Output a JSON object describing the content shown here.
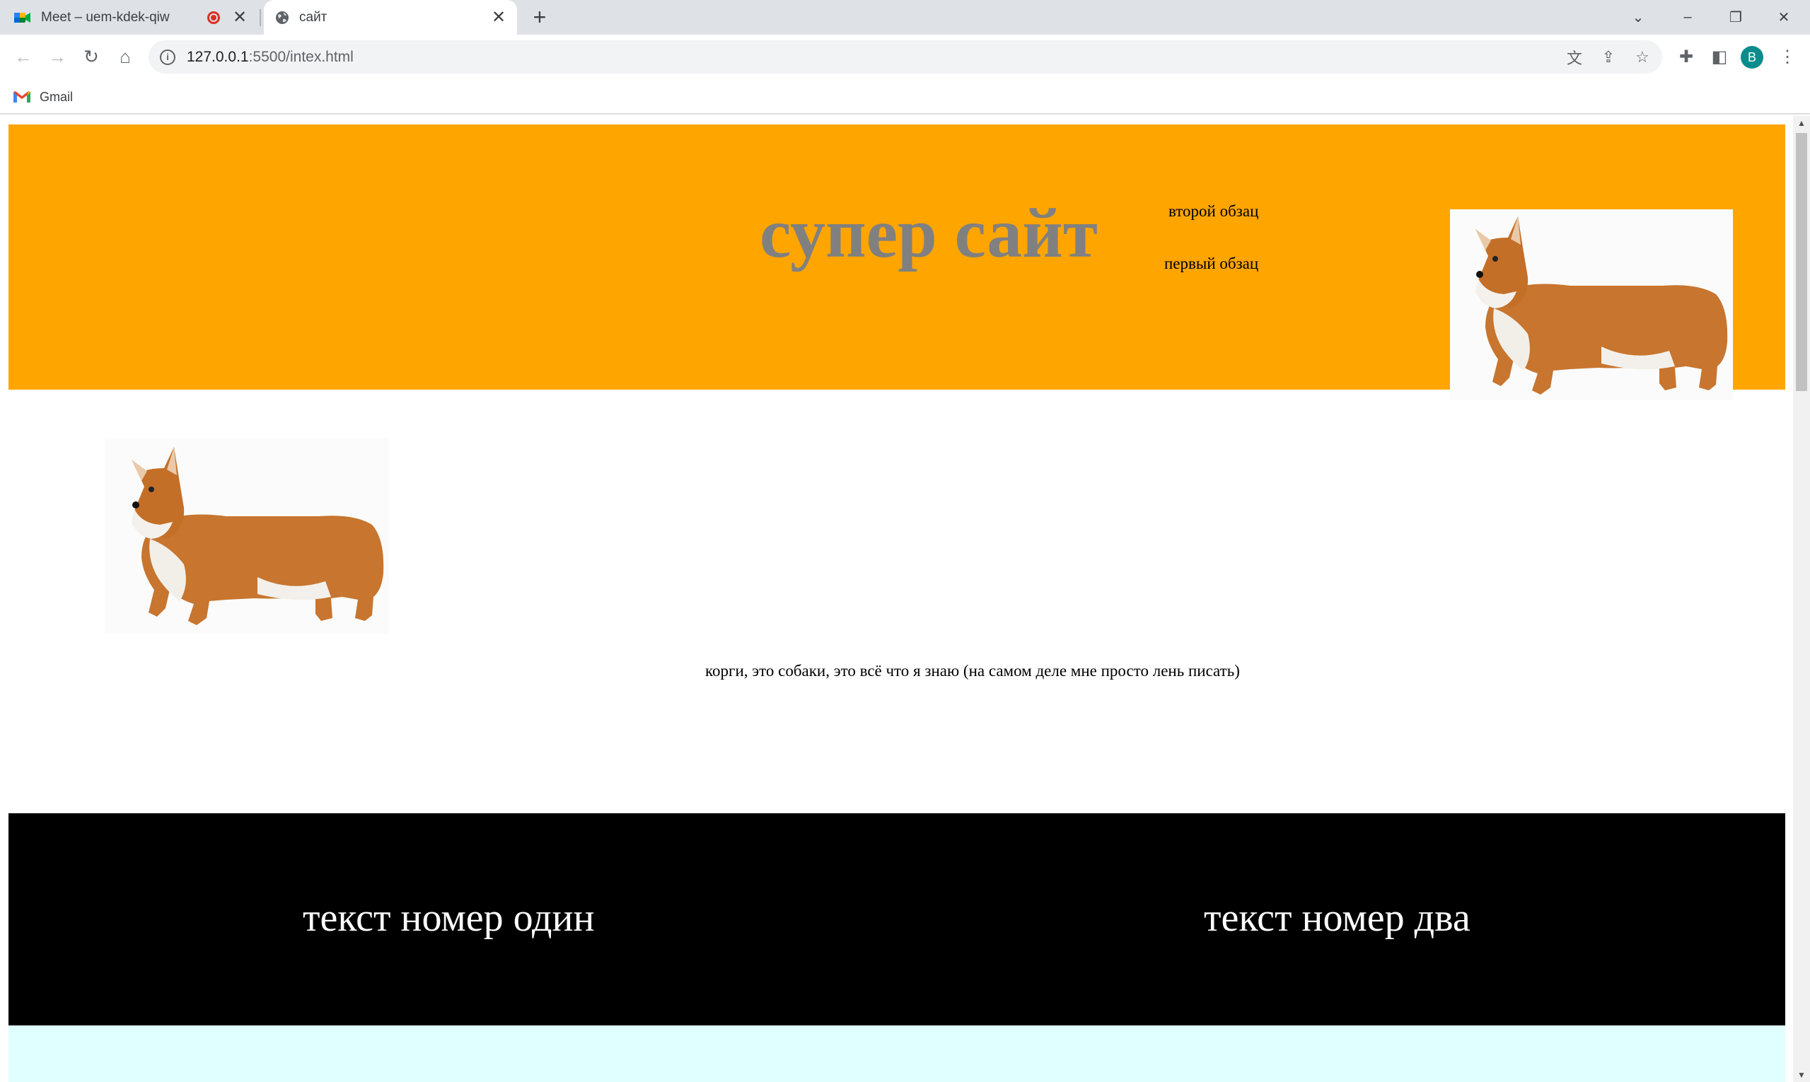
{
  "browser": {
    "tabs": [
      {
        "title": "Meet – uem-kdek-qiw",
        "icon": "google-meet-icon",
        "recording": true
      },
      {
        "title": "сайт",
        "icon": "globe-icon",
        "active": true
      }
    ],
    "url_host": "127.0.0.1",
    "url_path": ":5500/intex.html",
    "profile_initial": "B",
    "bookmarks": [
      {
        "label": "Gmail",
        "icon": "gmail-icon"
      }
    ]
  },
  "page": {
    "header": {
      "title": "супер сайт",
      "paragraph_two": "второй обзац",
      "paragraph_one": "первый обзац",
      "background": "#ffa500",
      "title_color": "#808080"
    },
    "main": {
      "text": "корги, это собаки, это всё что я знаю (на самом деле мне просто лень писать)"
    },
    "footer": {
      "text_one": "текст номер один",
      "text_two": "текст номер два",
      "background": "#000000",
      "text_color": "#ffffff"
    },
    "bottom_band_color": "#e0ffff"
  }
}
